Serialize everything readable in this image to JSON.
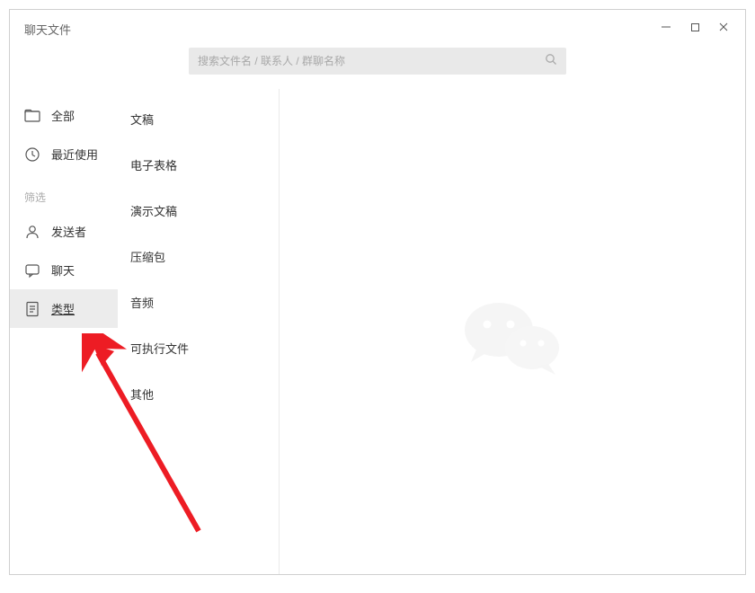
{
  "window": {
    "title": "聊天文件"
  },
  "search": {
    "placeholder": "搜索文件名 / 联系人 / 群聊名称"
  },
  "sidebar": {
    "items": [
      {
        "label": "全部",
        "icon": "folder-icon"
      },
      {
        "label": "最近使用",
        "icon": "clock-icon"
      }
    ],
    "filter_label": "筛选",
    "filter_items": [
      {
        "label": "发送者",
        "icon": "user-icon"
      },
      {
        "label": "聊天",
        "icon": "chat-icon"
      },
      {
        "label": "类型",
        "icon": "document-icon",
        "selected": true
      }
    ]
  },
  "types": [
    "文稿",
    "电子表格",
    "演示文稿",
    "压缩包",
    "音频",
    "可执行文件",
    "其他"
  ]
}
